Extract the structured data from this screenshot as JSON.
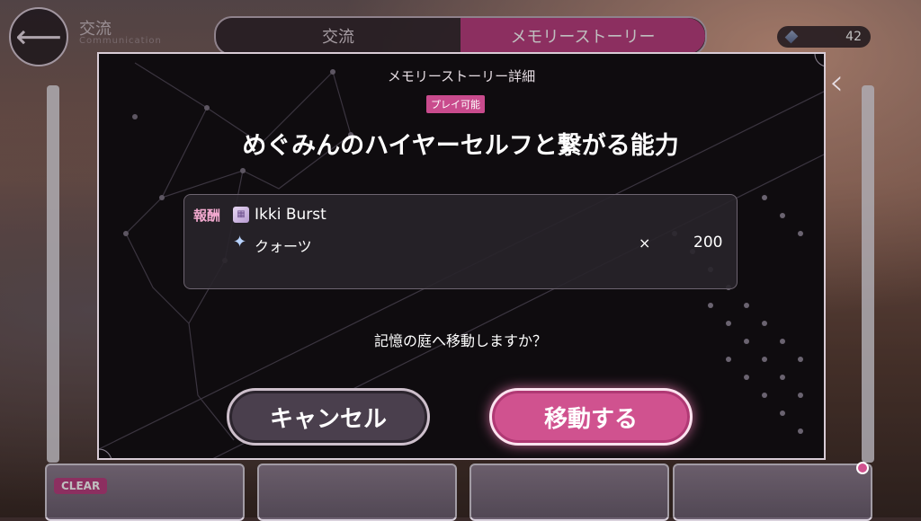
{
  "topbar": {
    "screen_title": "交流",
    "screen_subtitle": "Communication",
    "tabs": [
      {
        "label": "交流",
        "active": false
      },
      {
        "label": "メモリーストーリー",
        "active": true
      }
    ],
    "currency_value": "42"
  },
  "background": {
    "clear_badge": "CLEAR"
  },
  "modal": {
    "header": "メモリーストーリー詳細",
    "status_badge": "プレイ可能",
    "story_title": "めぐみんのハイヤーセルフと繋がる能力",
    "reward": {
      "label": "報酬",
      "items": [
        {
          "name": "Ikki Burst",
          "icon": "card-icon"
        },
        {
          "name": "クォーツ",
          "icon": "quartz-icon",
          "multiplier": "×",
          "quantity": "200"
        }
      ]
    },
    "question": "記憶の庭へ移動しますか？",
    "cancel_label": "キャンセル",
    "confirm_label": "移動する"
  },
  "colors": {
    "accent_pink": "#d0528f",
    "badge_pink": "#c94b8d",
    "modal_bg": "#0f0c0f"
  }
}
